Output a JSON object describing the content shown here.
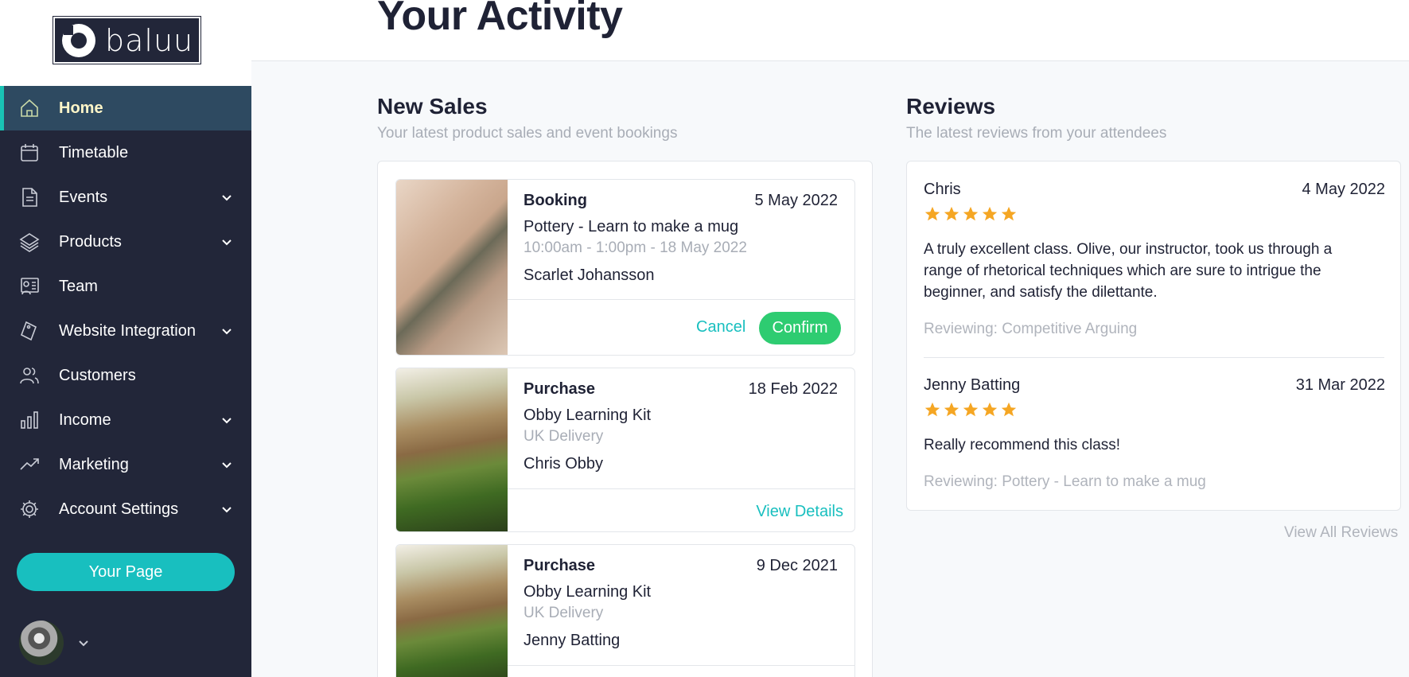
{
  "brand": {
    "logo_text": "baluu"
  },
  "sidebar": {
    "items": [
      {
        "label": "Home",
        "icon": "home-icon",
        "active": true,
        "has_chevron": false
      },
      {
        "label": "Timetable",
        "icon": "calendar-icon",
        "active": false,
        "has_chevron": false
      },
      {
        "label": "Events",
        "icon": "document-icon",
        "active": false,
        "has_chevron": true
      },
      {
        "label": "Products",
        "icon": "layers-icon",
        "active": false,
        "has_chevron": true
      },
      {
        "label": "Team",
        "icon": "team-board-icon",
        "active": false,
        "has_chevron": false
      },
      {
        "label": "Website Integration",
        "icon": "tag-icon",
        "active": false,
        "has_chevron": true
      },
      {
        "label": "Customers",
        "icon": "users-icon",
        "active": false,
        "has_chevron": false
      },
      {
        "label": "Income",
        "icon": "bar-chart-icon",
        "active": false,
        "has_chevron": true
      },
      {
        "label": "Marketing",
        "icon": "trend-line-icon",
        "active": false,
        "has_chevron": true
      },
      {
        "label": "Account Settings",
        "icon": "gear-icon",
        "active": false,
        "has_chevron": true
      }
    ],
    "your_page_label": "Your Page"
  },
  "header": {
    "title": "Your Activity"
  },
  "new_sales": {
    "title": "New Sales",
    "subtitle": "Your latest product sales and event bookings",
    "items": [
      {
        "type": "Booking",
        "date": "5 May 2022",
        "item": "Pottery - Learn to make a mug",
        "detail": "10:00am - 1:00pm - 18 May 2022",
        "customer": "Scarlet Johansson",
        "actions": {
          "cancel": "Cancel",
          "confirm": "Confirm"
        }
      },
      {
        "type": "Purchase",
        "date": "18 Feb 2022",
        "item": "Obby Learning Kit",
        "detail": "UK Delivery",
        "customer": "Chris Obby",
        "actions": {
          "view": "View Details"
        }
      },
      {
        "type": "Purchase",
        "date": "9 Dec 2021",
        "item": "Obby Learning Kit",
        "detail": "UK Delivery",
        "customer": "Jenny Batting"
      }
    ]
  },
  "reviews": {
    "title": "Reviews",
    "subtitle": "The latest reviews from your attendees",
    "items": [
      {
        "name": "Chris",
        "date": "4 May 2022",
        "rating": 5,
        "text": "A truly excellent class. Olive, our instructor, took us through a range of rhetorical techniques which are sure to intrigue the beginner, and satisfy the dilettante.",
        "reviewing": "Reviewing: Competitive Arguing"
      },
      {
        "name": "Jenny Batting",
        "date": "31 Mar 2022",
        "rating": 5,
        "text": "Really recommend this class!",
        "reviewing": "Reviewing: Pottery - Learn to make a mug"
      }
    ],
    "view_all": "View All Reviews"
  },
  "colors": {
    "sidebar_bg": "#222639",
    "active_bg": "#2e4a61",
    "accent_teal": "#18bfbf",
    "confirm_green": "#2ecc71",
    "star_gold": "#f5a623"
  }
}
